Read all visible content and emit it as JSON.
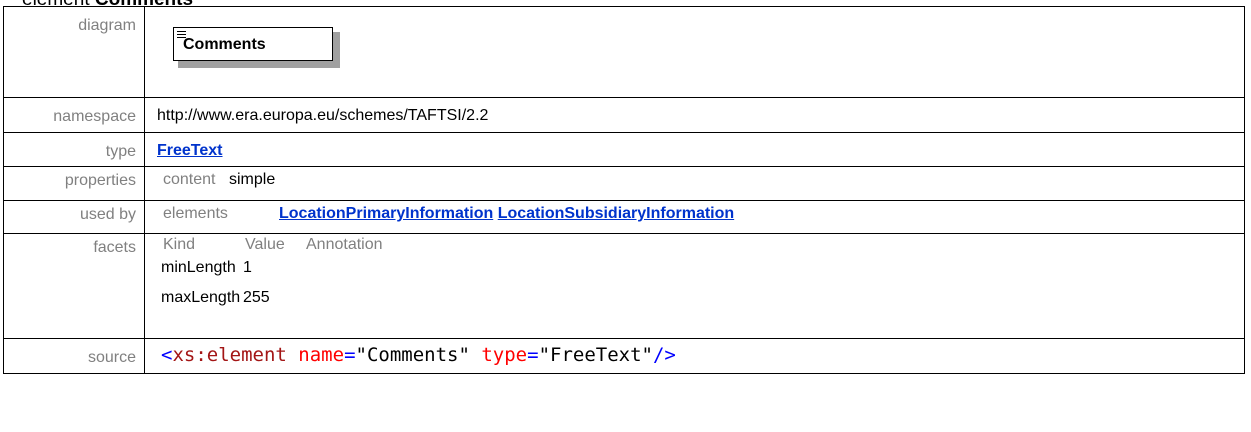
{
  "heading": {
    "prefix": "element ",
    "name": "Comments"
  },
  "labels": {
    "diagram": "diagram",
    "namespace": "namespace",
    "type": "type",
    "properties": "properties",
    "used_by": "used by",
    "facets": "facets",
    "source": "source"
  },
  "diagram": {
    "element_name": "Comments",
    "icon": "element-lines-icon"
  },
  "namespace": "http://www.era.europa.eu/schemes/TAFTSI/2.2",
  "type": {
    "link": "FreeText"
  },
  "properties": {
    "key": "content",
    "value": "simple"
  },
  "used_by": {
    "key": "elements",
    "links": [
      "LocationPrimaryInformation",
      "LocationSubsidiaryInformation"
    ]
  },
  "facets": {
    "headers": [
      "Kind",
      "Value",
      "Annotation"
    ],
    "rows": [
      {
        "kind": "minLength",
        "value": "1"
      },
      {
        "kind": "maxLength",
        "value": "255"
      }
    ]
  },
  "source": {
    "open": "<",
    "tag": "xs:element",
    "attr1_name": "name",
    "eq1": "=",
    "attr1_value": "\"Comments\"",
    "attr2_name": "type",
    "eq2": "=",
    "attr2_value": "\"FreeText\"",
    "close": "/>"
  },
  "colors": {
    "link": "#0033cc",
    "label": "#808080",
    "xml_tag": "#a31515",
    "xml_attr": "#ff0000",
    "xml_punct": "#0000ff"
  }
}
